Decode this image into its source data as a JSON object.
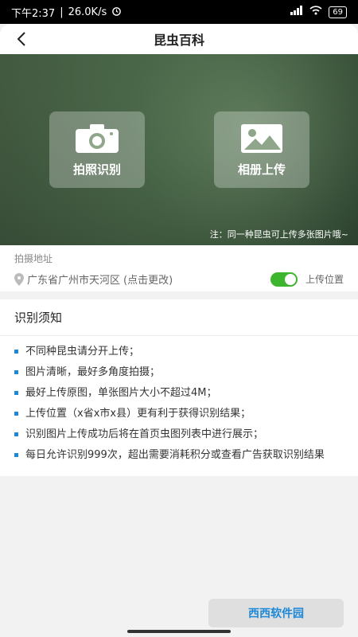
{
  "status": {
    "time": "下午2:37",
    "speed": "26.0K/s",
    "battery": "69"
  },
  "header": {
    "title": "昆虫百科"
  },
  "hero": {
    "camera_label": "拍照识别",
    "album_label": "相册上传",
    "note": "注：同一种昆虫可上传多张图片哦~"
  },
  "location": {
    "label": "拍摄地址",
    "address": "广东省广州市天河区",
    "change_hint": "(点击更改)",
    "upload_label": "上传位置",
    "upload_enabled": true
  },
  "notice": {
    "heading": "识别须知",
    "items": [
      "不同种昆虫请分开上传；",
      "图片清晰，最好多角度拍摄；",
      "最好上传原图，单张图片大小不超过4M；",
      "上传位置（x省x市x县）更有利于获得识别结果；",
      "识别图片上传成功后将在首页虫图列表中进行展示；",
      "每日允许识别999次，超出需要消耗积分或查看广告获取识别结果"
    ]
  },
  "watermark": {
    "text": "西西软件园"
  },
  "colors": {
    "accent": "#1e88d8",
    "toggle_on": "#3db52e"
  }
}
